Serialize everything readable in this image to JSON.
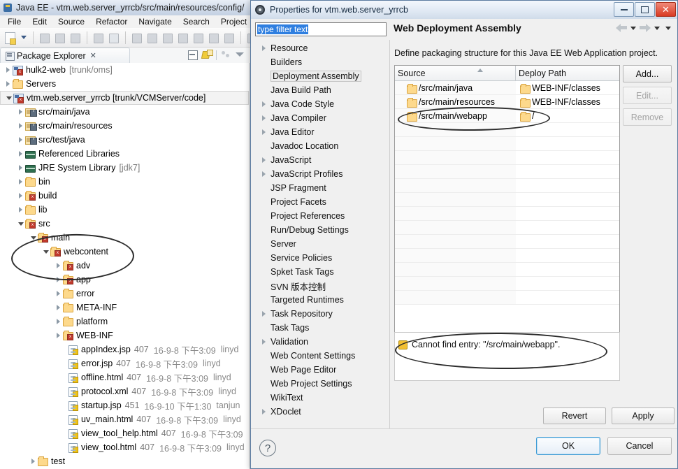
{
  "eclipse": {
    "window_title": "Java EE - vtm.web.server_yrrcb/src/main/resources/config/",
    "window_icon": "eclipse-icon",
    "menu": [
      "File",
      "Edit",
      "Source",
      "Refactor",
      "Navigate",
      "Search",
      "Project"
    ],
    "toolbar_icons": [
      "new-wizard-icon",
      "dropdown-caret-icon",
      "save-icon",
      "save-all-icon",
      "print-icon",
      "toggle-numbers-icon",
      "skip-breakpoints-icon",
      "run-icon",
      "pause-icon",
      "stop-icon",
      "disconnect-icon",
      "step-into-icon",
      "step-over-icon",
      "step-return-icon",
      "menu-icon"
    ],
    "view": {
      "tab_label": "Package Explorer",
      "tab_icon": "package-explorer-icon",
      "close_glyph": "✕",
      "actions": [
        "collapse-all-icon",
        "link-with-editor-icon",
        "view-menu-icon",
        "minimize-icon"
      ]
    },
    "tree": [
      {
        "indent": 0,
        "arrow": "closed",
        "icon": "java-project-icon",
        "label": "hulk2-web",
        "suffix": "[trunk/oms]",
        "selected": false
      },
      {
        "indent": 0,
        "arrow": "closed",
        "icon": "folder-icon",
        "label": "Servers",
        "suffix": "",
        "selected": false
      },
      {
        "indent": 0,
        "arrow": "open",
        "icon": "java-project-icon",
        "label": "vtm.web.server_yrrcb [trunk/VCMServer/code]",
        "suffix": "",
        "selected": true
      },
      {
        "indent": 1,
        "arrow": "closed",
        "icon": "source-folder-icon",
        "label": "src/main/java",
        "suffix": "",
        "selected": false
      },
      {
        "indent": 1,
        "arrow": "closed",
        "icon": "source-folder-icon",
        "label": "src/main/resources",
        "suffix": "",
        "selected": false
      },
      {
        "indent": 1,
        "arrow": "closed",
        "icon": "source-folder-icon",
        "label": "src/test/java",
        "suffix": "",
        "selected": false
      },
      {
        "indent": 1,
        "arrow": "closed",
        "icon": "library-icon",
        "label": "Referenced Libraries",
        "suffix": "",
        "selected": false
      },
      {
        "indent": 1,
        "arrow": "closed",
        "icon": "library-icon",
        "label": "JRE System Library",
        "suffix": "[jdk7]",
        "selected": false
      },
      {
        "indent": 1,
        "arrow": "closed",
        "icon": "folder-icon",
        "label": "bin",
        "suffix": "",
        "selected": false
      },
      {
        "indent": 1,
        "arrow": "closed",
        "icon": "folder-svn-icon",
        "label": "build",
        "suffix": "",
        "selected": false
      },
      {
        "indent": 1,
        "arrow": "closed",
        "icon": "folder-icon",
        "label": "lib",
        "suffix": "",
        "selected": false
      },
      {
        "indent": 1,
        "arrow": "open",
        "icon": "folder-svn-icon",
        "label": "src",
        "suffix": "",
        "selected": false
      },
      {
        "indent": 2,
        "arrow": "open",
        "icon": "folder-svn-icon",
        "label": "main",
        "suffix": "",
        "selected": false
      },
      {
        "indent": 3,
        "arrow": "open",
        "icon": "folder-svn-icon",
        "label": "webcontent",
        "suffix": "",
        "selected": false
      },
      {
        "indent": 4,
        "arrow": "closed",
        "icon": "folder-svn-icon",
        "label": "adv",
        "suffix": "",
        "selected": false
      },
      {
        "indent": 4,
        "arrow": "closed",
        "icon": "folder-svn-icon",
        "label": "app",
        "suffix": "",
        "selected": false
      },
      {
        "indent": 4,
        "arrow": "closed",
        "icon": "folder-icon",
        "label": "error",
        "suffix": "",
        "selected": false
      },
      {
        "indent": 4,
        "arrow": "closed",
        "icon": "folder-icon",
        "label": "META-INF",
        "suffix": "",
        "selected": false
      },
      {
        "indent": 4,
        "arrow": "closed",
        "icon": "folder-icon",
        "label": "platform",
        "suffix": "",
        "selected": false
      },
      {
        "indent": 4,
        "arrow": "closed",
        "icon": "folder-svn-icon",
        "label": "WEB-INF",
        "suffix": "",
        "selected": false
      }
    ],
    "files": [
      {
        "icon": "jsp-file-icon",
        "name": "appIndex.jsp",
        "rev": "407",
        "date": "16-9-8 下午3:09",
        "author": "linyd"
      },
      {
        "icon": "jsp-file-icon",
        "name": "error.jsp",
        "rev": "407",
        "date": "16-9-8 下午3:09",
        "author": "linyd"
      },
      {
        "icon": "html-file-icon",
        "name": "offline.html",
        "rev": "407",
        "date": "16-9-8 下午3:09",
        "author": "linyd"
      },
      {
        "icon": "xml-file-icon",
        "name": "protocol.xml",
        "rev": "407",
        "date": "16-9-8 下午3:09",
        "author": "linyd"
      },
      {
        "icon": "jsp-file-icon",
        "name": "startup.jsp",
        "rev": "451",
        "date": "16-9-10 下午1:30",
        "author": "tanjun"
      },
      {
        "icon": "html-file-icon",
        "name": "uv_main.html",
        "rev": "407",
        "date": "16-9-8 下午3:09",
        "author": "linyd"
      },
      {
        "icon": "html-file-icon",
        "name": "view_tool_help.html",
        "rev": "407",
        "date": "16-9-8 下午3:09",
        "author": ""
      },
      {
        "icon": "html-file-icon",
        "name": "view_tool.html",
        "rev": "407",
        "date": "16-9-8 下午3:09",
        "author": "linyd"
      }
    ],
    "last_row": {
      "icon": "folder-icon",
      "label": "test"
    }
  },
  "dialog": {
    "title": "Properties for vtm.web.server_yrrcb",
    "title_icon": "properties-gear-icon",
    "window_buttons": [
      "minimize-button",
      "maximize-button",
      "close-button"
    ],
    "filter": {
      "value": "type filter text",
      "placeholder": "type filter text"
    },
    "page_title": "Web Deployment Assembly",
    "nav": [
      "back-arrow-icon",
      "back-dropdown-icon",
      "forward-arrow-icon",
      "forward-dropdown-icon",
      "page-menu-icon"
    ],
    "tree": [
      {
        "label": "Resource",
        "arrow": true,
        "selected": false
      },
      {
        "label": "Builders",
        "arrow": false,
        "selected": false
      },
      {
        "label": "Deployment Assembly",
        "arrow": false,
        "selected": true
      },
      {
        "label": "Java Build Path",
        "arrow": false,
        "selected": false
      },
      {
        "label": "Java Code Style",
        "arrow": true,
        "selected": false
      },
      {
        "label": "Java Compiler",
        "arrow": true,
        "selected": false
      },
      {
        "label": "Java Editor",
        "arrow": true,
        "selected": false
      },
      {
        "label": "Javadoc Location",
        "arrow": false,
        "selected": false
      },
      {
        "label": "JavaScript",
        "arrow": true,
        "selected": false
      },
      {
        "label": "JavaScript Profiles",
        "arrow": true,
        "selected": false
      },
      {
        "label": "JSP Fragment",
        "arrow": false,
        "selected": false
      },
      {
        "label": "Project Facets",
        "arrow": false,
        "selected": false
      },
      {
        "label": "Project References",
        "arrow": false,
        "selected": false
      },
      {
        "label": "Run/Debug Settings",
        "arrow": false,
        "selected": false
      },
      {
        "label": "Server",
        "arrow": false,
        "selected": false
      },
      {
        "label": "Service Policies",
        "arrow": false,
        "selected": false
      },
      {
        "label": "Spket Task Tags",
        "arrow": false,
        "selected": false
      },
      {
        "label": "SVN 版本控制",
        "arrow": false,
        "selected": false
      },
      {
        "label": "Targeted Runtimes",
        "arrow": false,
        "selected": false
      },
      {
        "label": "Task Repository",
        "arrow": true,
        "selected": false
      },
      {
        "label": "Task Tags",
        "arrow": false,
        "selected": false
      },
      {
        "label": "Validation",
        "arrow": true,
        "selected": false
      },
      {
        "label": "Web Content Settings",
        "arrow": false,
        "selected": false
      },
      {
        "label": "Web Page Editor",
        "arrow": false,
        "selected": false
      },
      {
        "label": "Web Project Settings",
        "arrow": false,
        "selected": false
      },
      {
        "label": "WikiText",
        "arrow": false,
        "selected": false
      },
      {
        "label": "XDoclet",
        "arrow": true,
        "selected": false
      }
    ],
    "description": "Define packaging structure for this Java EE Web Application project.",
    "table": {
      "columns": [
        "Source",
        "Deploy Path"
      ],
      "rows": [
        {
          "source": "/src/main/java",
          "deploy": "WEB-INF/classes"
        },
        {
          "source": "/src/main/resources",
          "deploy": "WEB-INF/classes"
        },
        {
          "source": "/src/main/webapp",
          "deploy": "/"
        }
      ],
      "empty_rows": 13,
      "scrollbar_grip": "‖"
    },
    "side_buttons": [
      {
        "label": "Add...",
        "enabled": true
      },
      {
        "label": "Edit...",
        "enabled": false
      },
      {
        "label": "Remove",
        "enabled": false
      }
    ],
    "message": {
      "icon": "warning-icon",
      "text": "Cannot find entry: \"/src/main/webapp\"."
    },
    "apply_buttons": [
      {
        "label": "Revert"
      },
      {
        "label": "Apply"
      }
    ],
    "help_button": "?",
    "footer_buttons": [
      {
        "label": "OK",
        "primary": true
      },
      {
        "label": "Cancel",
        "primary": false
      }
    ]
  },
  "annotations": {
    "ellipse_tree_label": "webcontent-highlight",
    "ellipse_table_label": "webapp-row-highlight",
    "ellipse_message_label": "error-message-highlight"
  },
  "colors": {
    "selection_blue": "#2f7fe0",
    "ok_border": "#3c9ad4",
    "warning_yellow": "#f2c033",
    "annotation_ink": "#2c2c2c"
  }
}
